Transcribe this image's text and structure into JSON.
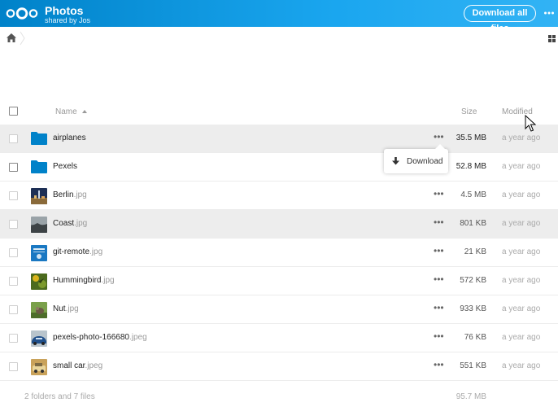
{
  "header": {
    "title": "Photos",
    "subtitle": "shared by Jos",
    "download_all_label": "Download all files",
    "menu_icon": "ellipsis-icon",
    "brand_color": "#0082c9"
  },
  "breadcrumb": {
    "home_icon": "home-icon",
    "view_toggle_icon": "grid-view-icon"
  },
  "table": {
    "columns": {
      "name": "Name",
      "size": "Size",
      "modified": "Modified"
    },
    "sort": {
      "column": "name",
      "direction": "ascending"
    },
    "rows": [
      {
        "type": "folder",
        "name": "airplanes",
        "ext": "",
        "size": "35.5 MB",
        "modified": "a year ago",
        "hovered": true
      },
      {
        "type": "folder",
        "name": "Pexels",
        "ext": "",
        "size": "52.8 MB",
        "modified": "a year ago"
      },
      {
        "type": "image",
        "name": "Berlin",
        "ext": ".jpg",
        "size": "4.5 MB",
        "modified": "a year ago"
      },
      {
        "type": "image",
        "name": "Coast",
        "ext": ".jpg",
        "size": "801 KB",
        "modified": "a year ago"
      },
      {
        "type": "image",
        "name": "git-remote",
        "ext": ".jpg",
        "size": "21 KB",
        "modified": "a year ago"
      },
      {
        "type": "image",
        "name": "Hummingbird",
        "ext": ".jpg",
        "size": "572 KB",
        "modified": "a year ago"
      },
      {
        "type": "image",
        "name": "Nut",
        "ext": ".jpg",
        "size": "933 KB",
        "modified": "a year ago"
      },
      {
        "type": "image",
        "name": "pexels-photo-166680",
        "ext": ".jpeg",
        "size": "76 KB",
        "modified": "a year ago"
      },
      {
        "type": "image",
        "name": "small car",
        "ext": ".jpeg",
        "size": "551 KB",
        "modified": "a year ago"
      }
    ]
  },
  "popover": {
    "download_label": "Download",
    "download_icon": "download-arrow-icon"
  },
  "footer": {
    "summary": "2 folders and 7 files",
    "total_size": "95.7 MB"
  },
  "colors": {
    "folder": "#0082c9",
    "hover_row": "#ededed"
  }
}
